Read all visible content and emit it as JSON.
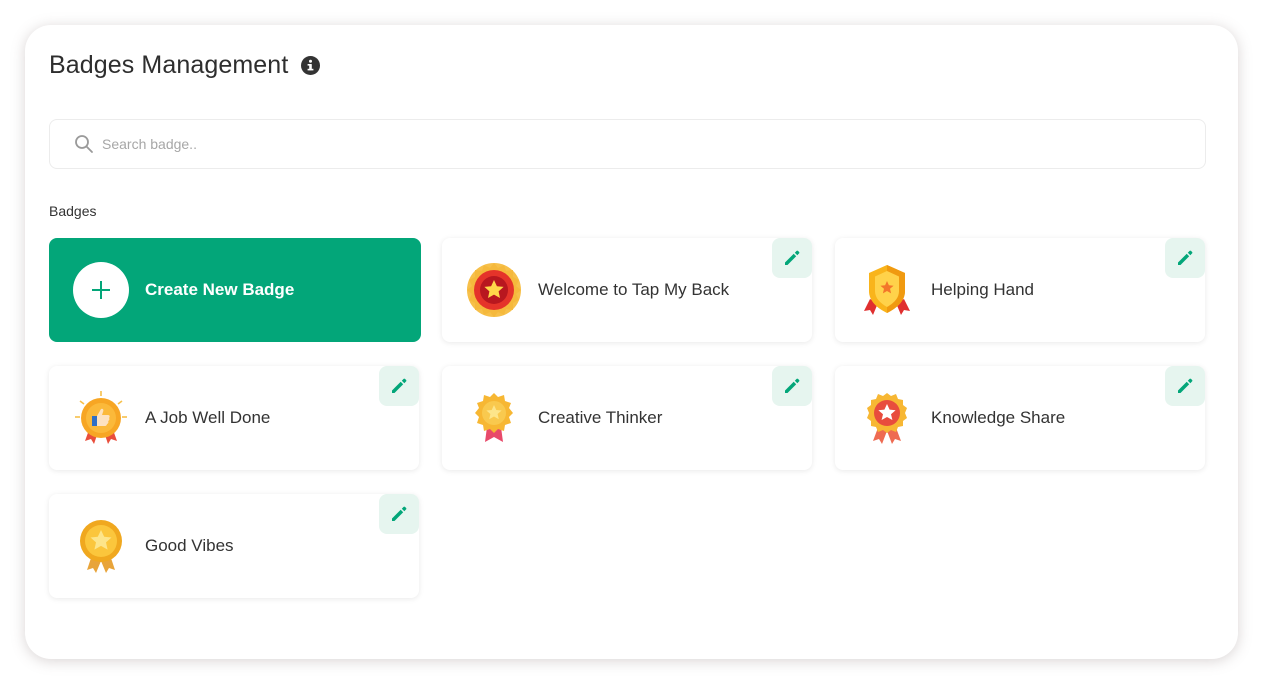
{
  "header": {
    "title": "Badges Management",
    "info_icon": "info-icon"
  },
  "search": {
    "placeholder": "Search badge..",
    "value": ""
  },
  "section": {
    "label": "Badges"
  },
  "create": {
    "label": "Create New Badge",
    "icon": "plus-icon"
  },
  "colors": {
    "accent": "#03a679",
    "edit_bg": "#e6f5ef"
  },
  "badges": [
    {
      "label": "Welcome to Tap My Back",
      "icon": "red-star-medal-icon"
    },
    {
      "label": "Helping Hand",
      "icon": "shield-badge-icon"
    },
    {
      "label": "A Job Well Done",
      "icon": "thumbs-up-medal-icon"
    },
    {
      "label": "Creative Thinker",
      "icon": "gold-star-medal-icon"
    },
    {
      "label": "Knowledge Share",
      "icon": "rosette-star-icon"
    },
    {
      "label": "Good Vibes",
      "icon": "gold-medal-icon"
    }
  ]
}
